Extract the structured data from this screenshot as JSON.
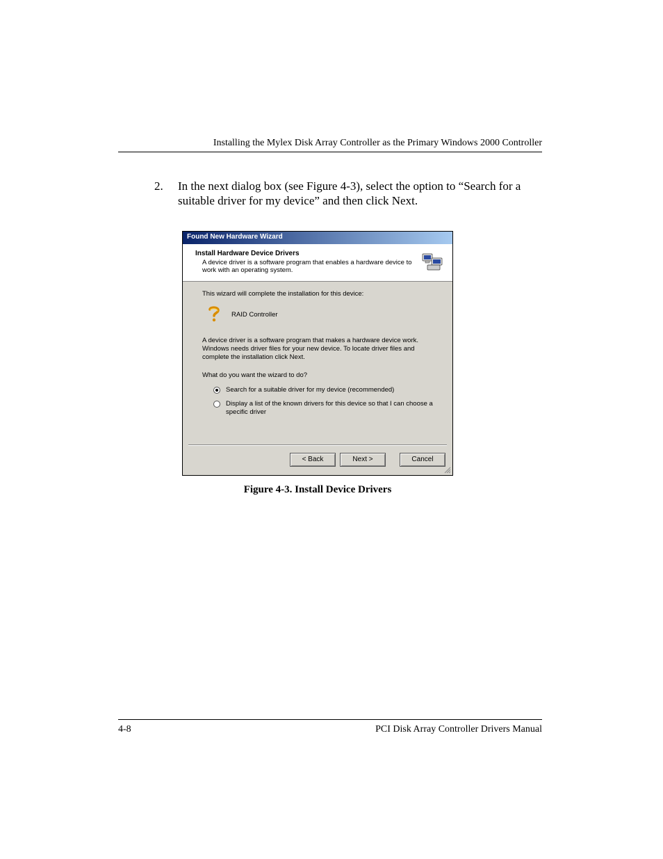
{
  "header": {
    "running": "Installing the Mylex Disk Array Controller as the Primary Windows 2000 Controller"
  },
  "step": {
    "num": "2.",
    "text": "In the next dialog box (see Figure  4-3), select the option to “Search for a suitable driver for my device” and then click Next."
  },
  "dialog": {
    "title": "Found New Hardware Wizard",
    "header_title": "Install Hardware Device Drivers",
    "header_sub": "A device driver is a software program that enables a hardware device to work with an operating system.",
    "line1": "This wizard will complete the installation for this device:",
    "device": "RAID Controller",
    "para": "A device driver is a software program that makes a hardware device work. Windows needs driver files for your new device. To locate driver files and complete the installation click Next.",
    "prompt": "What do you want the wizard to do?",
    "opt1": "Search for a suitable driver for my device (recommended)",
    "opt2": "Display a list of the known drivers for this device so that I can choose a specific driver",
    "back": "< Back",
    "next": "Next >",
    "cancel": "Cancel"
  },
  "caption": "Figure 4-3. Install Device Drivers",
  "footer": {
    "page": "4-8",
    "manual": "PCI Disk Array Controller Drivers Manual"
  }
}
